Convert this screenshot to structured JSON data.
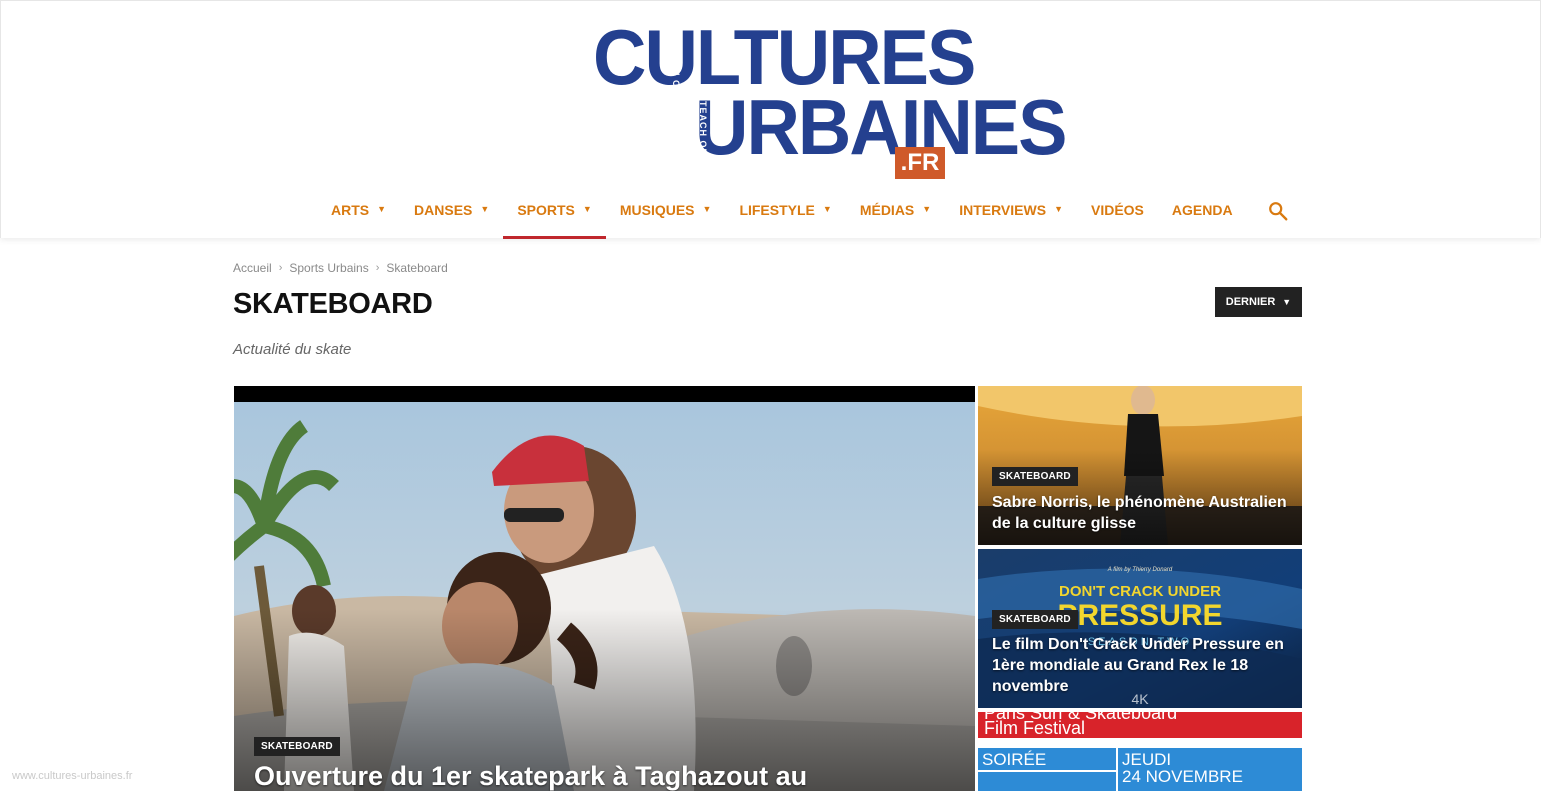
{
  "logo": {
    "line1": "CULTURES",
    "line2": "URBAINES",
    "tag_a": "EACH ONE",
    "tag_b": "TEACH ONE",
    "suffix": ".FR"
  },
  "nav": {
    "items": [
      {
        "label": "ARTS",
        "has_dropdown": true
      },
      {
        "label": "DANSES",
        "has_dropdown": true
      },
      {
        "label": "SPORTS",
        "has_dropdown": true,
        "active": true
      },
      {
        "label": "MUSIQUES",
        "has_dropdown": true
      },
      {
        "label": "LIFESTYLE",
        "has_dropdown": true
      },
      {
        "label": "MÉDIAS",
        "has_dropdown": true
      },
      {
        "label": "INTERVIEWS",
        "has_dropdown": true
      },
      {
        "label": "VIDÉOS",
        "has_dropdown": false
      },
      {
        "label": "AGENDA",
        "has_dropdown": false
      }
    ],
    "search_icon": "search-icon"
  },
  "breadcrumb": [
    "Accueil",
    "Sports Urbains",
    "Skateboard"
  ],
  "page": {
    "title": "SKATEBOARD",
    "description": "Actualité du skate",
    "sort_label": "DERNIER"
  },
  "articles": {
    "featured": {
      "category": "SKATEBOARD",
      "title": "Ouverture du 1er skatepark à Taghazout au"
    },
    "side": [
      {
        "category": "SKATEBOARD",
        "title": "Sabre Norris, le phénomène Australien de la culture glisse"
      },
      {
        "category": "SKATEBOARD",
        "title": "Le film Don't Crack Under Pressure en 1ère mondiale au Grand Rex le 18 novembre"
      }
    ],
    "third_image_text": {
      "line1": "Paris Surf & Skateboard",
      "line2": "Film Festival",
      "soiree": "SOIRÉE",
      "jeudi": "JEUDI",
      "date": "24 NOVEMBRE"
    },
    "poster_text": {
      "credit": "A film by Thierry Donard",
      "line1": "DON'T CRACK UNDER",
      "line2": "PRESSURE",
      "line3": "SEASON TWO",
      "badge": "4K"
    }
  },
  "watermark": "www.cultures-urbaines.fr",
  "colors": {
    "nav_text": "#d97a10",
    "nav_active_underline": "#c0272d",
    "logo_blue": "#24408f",
    "logo_orange": "#cf5a2a",
    "badge_bg": "#222222"
  }
}
